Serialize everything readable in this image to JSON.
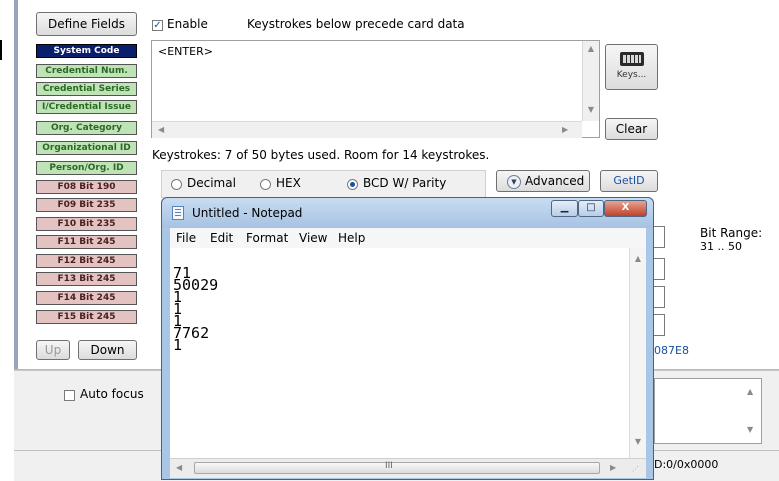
{
  "toolbar": {
    "define_fields": "Define Fields",
    "enable_label": "Enable",
    "enable_checked": true,
    "description": "Keystrokes below precede card data"
  },
  "fields": [
    {
      "label": "System Code",
      "style": "navy"
    },
    {
      "label": "Credential Num.",
      "style": "green"
    },
    {
      "label": "Credential Series",
      "style": "green"
    },
    {
      "label": "I/Credential Issue",
      "style": "green"
    },
    {
      "label": "Org. Category",
      "style": "green"
    },
    {
      "label": "Organizational ID",
      "style": "green"
    },
    {
      "label": "Person/Org. ID",
      "style": "green"
    },
    {
      "label": "F08 Bit 190",
      "style": "pink"
    },
    {
      "label": "F09 Bit 235",
      "style": "pink"
    },
    {
      "label": "F10 Bit 235",
      "style": "pink"
    },
    {
      "label": "F11 Bit 245",
      "style": "pink"
    },
    {
      "label": "F12 Bit 245",
      "style": "pink"
    },
    {
      "label": "F13 Bit 245",
      "style": "pink"
    },
    {
      "label": "F14 Bit 245",
      "style": "pink"
    },
    {
      "label": "F15 Bit 245",
      "style": "pink"
    }
  ],
  "nav": {
    "up": "Up",
    "down": "Down"
  },
  "keystrokes": {
    "content": "<ENTER>",
    "keys_button": "Keys...",
    "clear_button": "Clear",
    "usage": "Keystrokes: 7 of 50 bytes used. Room for 14 keystrokes."
  },
  "format": {
    "options": [
      "Decimal",
      "HEX",
      "BCD W/ Parity"
    ],
    "selected": "BCD W/ Parity",
    "advanced": "Advanced",
    "getid": "GetID"
  },
  "bit_range": {
    "label": "Bit Range:",
    "value": "31 .. 50"
  },
  "hex_fragment": "087E8",
  "auto_focus": "Auto focus",
  "status_fragment": "D:0/0x0000",
  "notepad": {
    "title": "Untitled - Notepad",
    "menu": [
      "File",
      "Edit",
      "Format",
      "View",
      "Help"
    ],
    "lines": [
      "71",
      "50029",
      "1",
      "1",
      "1",
      "7762",
      "1"
    ],
    "scroll_grip": "III"
  },
  "colors": {
    "navy": "#0a1e6e",
    "green": "#bfe3b6",
    "pink": "#e3c2c2",
    "link_blue": "#1b4fa0"
  }
}
